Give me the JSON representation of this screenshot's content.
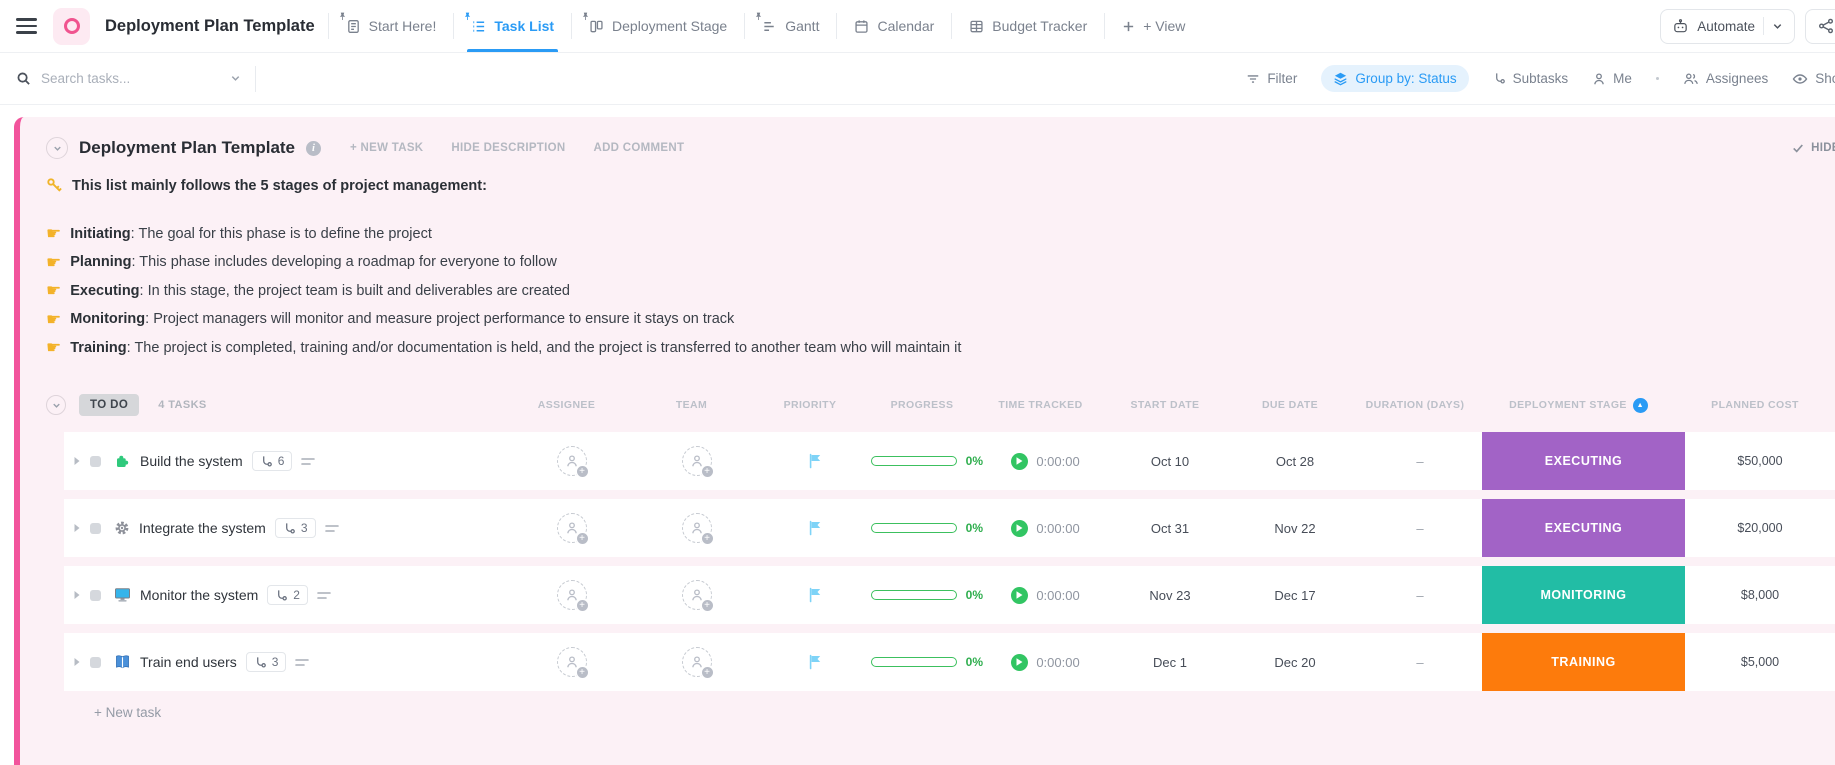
{
  "header": {
    "title": "Deployment Plan Template",
    "tabs": [
      {
        "label": "Start Here!",
        "icon": "doc",
        "pinned": true,
        "active": false
      },
      {
        "label": "Task List",
        "icon": "list",
        "pinned": true,
        "active": true
      },
      {
        "label": "Deployment Stage",
        "icon": "board",
        "pinned": true,
        "active": false
      },
      {
        "label": "Gantt",
        "icon": "gantt",
        "pinned": true,
        "active": false
      },
      {
        "label": "Calendar",
        "icon": "calendar",
        "pinned": false,
        "active": false
      },
      {
        "label": "Budget Tracker",
        "icon": "grid",
        "pinned": false,
        "active": false
      }
    ],
    "add_view_label": "+ View",
    "automate_label": "Automate"
  },
  "toolbar": {
    "search_placeholder": "Search tasks...",
    "filter_label": "Filter",
    "group_by_label": "Group by: Status",
    "subtasks_label": "Subtasks",
    "me_label": "Me",
    "assignees_label": "Assignees",
    "show_label": "Show"
  },
  "list": {
    "title": "Deployment Plan Template",
    "actions": {
      "new_task": "+ NEW TASK",
      "hide_description": "HIDE DESCRIPTION",
      "add_comment": "ADD COMMENT"
    },
    "hide_closed_label": "HIDE CLOSED",
    "description_heading": "This list mainly follows the 5 stages of project management:",
    "description_bullets": [
      {
        "term": "Initiating",
        "text": ": The goal for this phase is to define the project"
      },
      {
        "term": "Planning",
        "text": ": This phase includes developing a roadmap for everyone to follow"
      },
      {
        "term": "Executing",
        "text": ": In this stage, the project team is built and deliverables are created"
      },
      {
        "term": "Monitoring",
        "text": ": Project managers will monitor and measure project performance to ensure it stays on track"
      },
      {
        "term": "Training",
        "text": ": The project is completed, training and/or documentation is held, and the project is transferred to another team who will maintain it"
      }
    ]
  },
  "table": {
    "group_status": "TO DO",
    "group_count": "4 TASKS",
    "columns": [
      "ASSIGNEE",
      "TEAM",
      "PRIORITY",
      "PROGRESS",
      "TIME TRACKED",
      "START DATE",
      "DUE DATE",
      "DURATION (DAYS)",
      "DEPLOYMENT STAGE",
      "PLANNED COST"
    ],
    "sort": {
      "column": "DEPLOYMENT STAGE",
      "direction": "asc"
    },
    "rows": [
      {
        "icon": "puzzle",
        "name": "Build the system",
        "subtasks": "6",
        "progress": "0%",
        "time_tracked": "0:00:00",
        "start_date": "Oct 10",
        "due_date": "Oct 28",
        "duration": "–",
        "stage": "EXECUTING",
        "stage_color": "#a263c6",
        "planned_cost": "$50,000"
      },
      {
        "icon": "gear",
        "name": "Integrate the system",
        "subtasks": "3",
        "progress": "0%",
        "time_tracked": "0:00:00",
        "start_date": "Oct 31",
        "due_date": "Nov 22",
        "duration": "–",
        "stage": "EXECUTING",
        "stage_color": "#a263c6",
        "planned_cost": "$20,000"
      },
      {
        "icon": "monitor",
        "name": "Monitor the system",
        "subtasks": "2",
        "progress": "0%",
        "time_tracked": "0:00:00",
        "start_date": "Nov 23",
        "due_date": "Dec 17",
        "duration": "–",
        "stage": "MONITORING",
        "stage_color": "#22bda5",
        "planned_cost": "$8,000"
      },
      {
        "icon": "book",
        "name": "Train end users",
        "subtasks": "3",
        "progress": "0%",
        "time_tracked": "0:00:00",
        "start_date": "Dec 1",
        "due_date": "Dec 20",
        "duration": "–",
        "stage": "TRAINING",
        "stage_color": "#fd7b0c",
        "planned_cost": "$5,000"
      }
    ],
    "new_task_label": "+ New task"
  },
  "colors": {
    "accent_blue": "#2a9bf5",
    "pink": "#f2549c",
    "progress_green": "#32c563",
    "flag_blue": "#7ed3f7",
    "stage_executing": "#a263c6",
    "stage_monitoring": "#22bda5",
    "stage_training": "#fd7b0c"
  }
}
